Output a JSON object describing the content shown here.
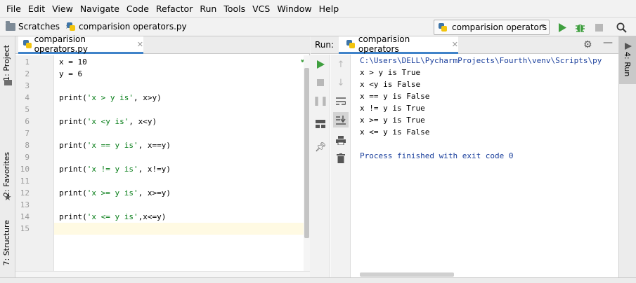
{
  "menu": [
    "File",
    "Edit",
    "View",
    "Navigate",
    "Code",
    "Refactor",
    "Run",
    "Tools",
    "VCS",
    "Window",
    "Help"
  ],
  "breadcrumb": {
    "root": "Scratches",
    "file": "comparision operators.py"
  },
  "run_config": {
    "label": "comparision operators"
  },
  "toolbar_icons": {
    "run": "play-icon",
    "debug": "bug-icon",
    "stop": "stop-icon",
    "search": "search-icon"
  },
  "left_strip": {
    "project": "1: Project",
    "favorites": "2: Favorites",
    "structure": "7: Structure"
  },
  "right_strip": {
    "run": "4: Run"
  },
  "editor": {
    "tab_label": "comparision operators.py",
    "lines": [
      {
        "n": "1",
        "pre": "x = 10",
        "str": "",
        "post": ""
      },
      {
        "n": "2",
        "pre": "y = 6",
        "str": "",
        "post": ""
      },
      {
        "n": "3",
        "pre": "",
        "str": "",
        "post": ""
      },
      {
        "n": "4",
        "pre": "print(",
        "str": "'x > y is'",
        "post": ", x>y)"
      },
      {
        "n": "5",
        "pre": "",
        "str": "",
        "post": ""
      },
      {
        "n": "6",
        "pre": "print(",
        "str": "'x <y is'",
        "post": ", x<y)"
      },
      {
        "n": "7",
        "pre": "",
        "str": "",
        "post": ""
      },
      {
        "n": "8",
        "pre": "print(",
        "str": "'x == y is'",
        "post": ", x==y)"
      },
      {
        "n": "9",
        "pre": "",
        "str": "",
        "post": ""
      },
      {
        "n": "10",
        "pre": "print(",
        "str": "'x != y is'",
        "post": ", x!=y)"
      },
      {
        "n": "11",
        "pre": "",
        "str": "",
        "post": ""
      },
      {
        "n": "12",
        "pre": "print(",
        "str": "'x >= y is'",
        "post": ", x>=y)"
      },
      {
        "n": "13",
        "pre": "",
        "str": "",
        "post": ""
      },
      {
        "n": "14",
        "pre": "print(",
        "str": "'x <= y is'",
        "post": ",x<=y)"
      },
      {
        "n": "15",
        "pre": "",
        "str": "",
        "post": ""
      }
    ]
  },
  "run_panel": {
    "label": "Run:",
    "tab_label": "comparision operators",
    "output": [
      {
        "text": "C:\\Users\\DELL\\PycharmProjects\\Fourth\\venv\\Scripts\\py",
        "blue": true
      },
      {
        "text": "x > y is True",
        "blue": false
      },
      {
        "text": "x <y is False",
        "blue": false
      },
      {
        "text": "x == y is False",
        "blue": false
      },
      {
        "text": "x != y is True",
        "blue": false
      },
      {
        "text": "x >= y is True",
        "blue": false
      },
      {
        "text": "x <= y is False",
        "blue": false
      },
      {
        "text": "",
        "blue": false
      },
      {
        "text": "Process finished with exit code 0",
        "blue": true
      }
    ]
  }
}
